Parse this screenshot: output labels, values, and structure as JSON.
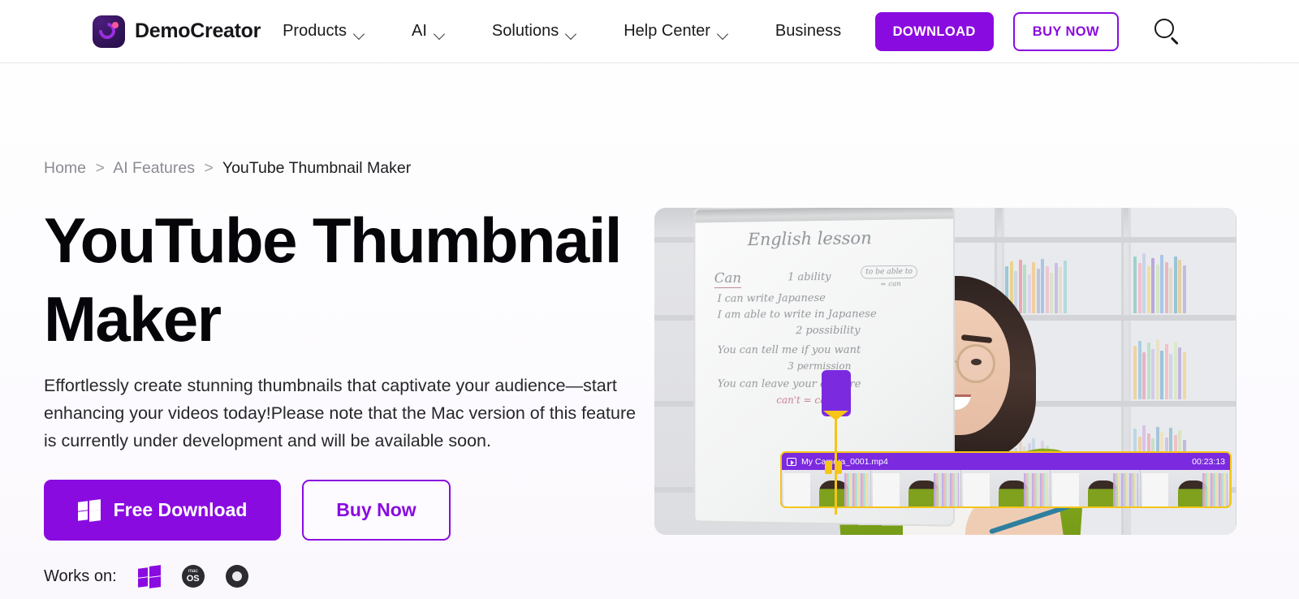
{
  "header": {
    "brand_name": "DemoCreator",
    "logo_icon": "democreator-logo-icon",
    "nav": [
      {
        "label": "Products",
        "has_chevron": true
      },
      {
        "label": "AI",
        "has_chevron": true
      },
      {
        "label": "Solutions",
        "has_chevron": true
      },
      {
        "label": "Help Center",
        "has_chevron": true
      },
      {
        "label": "Business",
        "has_chevron": false
      }
    ],
    "download_label": "DOWNLOAD",
    "buy_now_label": "BUY NOW",
    "search_icon": "search-icon",
    "accent_color": "#8a0be0",
    "border_color": "#e4e4e7"
  },
  "breadcrumb": {
    "items": [
      "Home",
      "AI Features",
      "YouTube Thumbnail Maker"
    ],
    "separator": ">",
    "link_color": "#8b8b93",
    "current_color": "#1c1c20"
  },
  "hero": {
    "title": "YouTube Thumbnail Maker",
    "description": "Effortlessly create stunning thumbnails that captivate your audience—start enhancing your videos today!Please note that the Mac version of this feature is currently under development and will be available soon.",
    "primary_cta": {
      "label": "Free Download",
      "icon": "windows-icon"
    },
    "secondary_cta": {
      "label": "Buy Now"
    },
    "works_on_label": "Works on:",
    "works_on_icons": [
      "windows-icon",
      "macos-icon",
      "chrome-icon"
    ],
    "macos_icon_top_text": "mac",
    "macos_icon_bottom_text": "OS"
  },
  "media": {
    "whiteboard": {
      "title": "English lesson",
      "keyword": "Can",
      "ability": "1 ability",
      "box_line1": "to be able to",
      "box_line2": "= can",
      "line1": "I can write Japanese",
      "line2": "I am able to write in Japanese",
      "line3": "2 possibility",
      "line4": "You can tell me if you want",
      "line5": "3 permission",
      "line6": "You can leave your on here",
      "line7": "can't = can not"
    },
    "timeline": {
      "clip_name": "My Camera_0001.mp4",
      "timecode": "00:23:13",
      "play_icon": "video-clip-icon",
      "frame_count": 5,
      "header_color": "#7b2ae0",
      "selection_color": "#f5c518"
    }
  }
}
